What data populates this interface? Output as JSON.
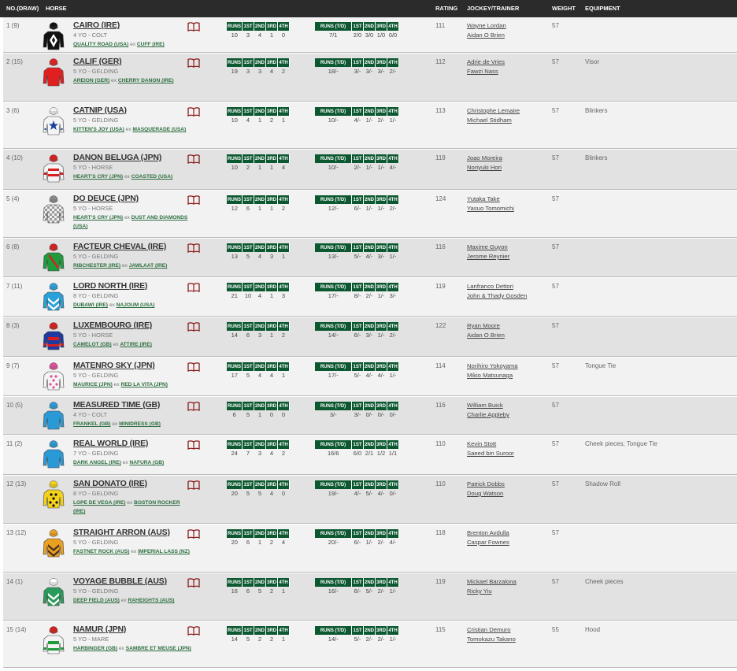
{
  "header": {
    "no_draw": "NO.(DRAW)",
    "horse": "HORSE",
    "rating": "RATING",
    "jockey_trainer": "JOCKEY/TRAINER",
    "weight": "WEIGHT",
    "equipment": "EQUIPMENT"
  },
  "stat_headers": {
    "runs": "RUNS",
    "runs_td": "RUNS (T/D)",
    "first": "1ST",
    "second": "2ND",
    "third": "3RD",
    "fourth": "4TH"
  },
  "pedigree_ex": "ex",
  "runners": [
    {
      "no": "1 (9)",
      "name": "CAIRO (IRE)",
      "info": "4 YO - COLT",
      "sire": "QUALITY ROAD (USA)",
      "dam": "CUFF (IRE)",
      "stats": [
        "10",
        "3",
        "4",
        "1",
        "0"
      ],
      "td": [
        "7/1",
        "2/0",
        "3/0",
        "1/0",
        "0/0"
      ],
      "rating": "111",
      "jockey": "Wayne Lordan",
      "trainer": "Aidan O Brien",
      "weight": "57",
      "equipment": "",
      "silk": {
        "body": "#111111",
        "accent": "#ffffff",
        "cap": "#111111",
        "pattern": "diamond"
      }
    },
    {
      "no": "2 (15)",
      "name": "CALIF (GER)",
      "info": "5 YO - GELDING",
      "sire": "AREION (GER)",
      "dam": "CHERRY DANON (IRE)",
      "stats": [
        "19",
        "3",
        "3",
        "4",
        "2"
      ],
      "td": [
        "18/-",
        "3/-",
        "3/-",
        "3/-",
        "2/-"
      ],
      "rating": "112",
      "jockey": "Adrie de Vries",
      "trainer": "Fawzi Nass",
      "weight": "57",
      "equipment": "Visor",
      "silk": {
        "body": "#e02020",
        "accent": "#e02020",
        "cap": "#e02020",
        "pattern": "plain"
      }
    },
    {
      "no": "3 (6)",
      "name": "CATNIP (USA)",
      "info": "5 YO - GELDING",
      "sire": "KITTEN'S JOY (USA)",
      "dam": "MASQUERADE (USA)",
      "stats": [
        "10",
        "4",
        "1",
        "2",
        "1"
      ],
      "td": [
        "10/-",
        "4/-",
        "1/-",
        "2/-",
        "1/-"
      ],
      "rating": "113",
      "jockey": "Christophe Lemaire",
      "trainer": "Michael Stidham",
      "weight": "57",
      "equipment": "Blinkers",
      "silk": {
        "body": "#f4f4f4",
        "accent": "#1a3d9c",
        "cap": "#f4f4f4",
        "pattern": "star"
      }
    },
    {
      "no": "4 (10)",
      "name": "DANON BELUGA (JPN)",
      "info": "5 YO - HORSE",
      "sire": "HEART'S CRY (JPN)",
      "dam": "COASTED (USA)",
      "stats": [
        "10",
        "2",
        "1",
        "1",
        "4"
      ],
      "td": [
        "10/-",
        "2/-",
        "1/-",
        "1/-",
        "4/-"
      ],
      "rating": "119",
      "jockey": "Joao Moreira",
      "trainer": "Noriyuki Hori",
      "weight": "57",
      "equipment": "Blinkers",
      "silk": {
        "body": "#f4f4f4",
        "accent": "#d81e1e",
        "cap": "#d81e1e",
        "pattern": "stripes"
      }
    },
    {
      "no": "5 (4)",
      "name": "DO DEUCE (JPN)",
      "info": "5 YO - HORSE",
      "sire": "HEART'S CRY (JPN)",
      "dam": "DUST AND DIAMONDS (USA)",
      "stats": [
        "12",
        "6",
        "1",
        "1",
        "2"
      ],
      "td": [
        "12/-",
        "6/-",
        "1/-",
        "1/-",
        "2/-"
      ],
      "rating": "124",
      "jockey": "Yutaka Take",
      "trainer": "Yasuo Tomomichi",
      "weight": "57",
      "equipment": "",
      "silk": {
        "body": "#9a9a9a",
        "accent": "#f0f0f0",
        "cap": "#888888",
        "pattern": "check"
      }
    },
    {
      "no": "6 (8)",
      "name": "FACTEUR CHEVAL (IRE)",
      "info": "5 YO - GELDING",
      "sire": "RIBCHESTER (IRE)",
      "dam": "JAWLAAT (IRE)",
      "stats": [
        "13",
        "5",
        "4",
        "3",
        "1"
      ],
      "td": [
        "13/-",
        "5/-",
        "4/-",
        "3/-",
        "1/-"
      ],
      "rating": "116",
      "jockey": "Maxime Guyon",
      "trainer": "Jerome Reynier",
      "weight": "57",
      "equipment": "",
      "silk": {
        "body": "#1f9a3c",
        "accent": "#d62020",
        "cap": "#d62020",
        "pattern": "sash"
      }
    },
    {
      "no": "7 (11)",
      "name": "LORD NORTH (IRE)",
      "info": "8 YO - GELDING",
      "sire": "DUBAWI (IRE)",
      "dam": "NAJOUM (USA)",
      "stats": [
        "21",
        "10",
        "4",
        "1",
        "3"
      ],
      "td": [
        "17/-",
        "8/-",
        "2/-",
        "1/-",
        "3/-"
      ],
      "rating": "119",
      "jockey": "Lanfranco Dettori",
      "trainer": "John & Thady Gosden",
      "weight": "57",
      "equipment": "",
      "silk": {
        "body": "#2aa0d8",
        "accent": "#ffffff",
        "cap": "#2aa0d8",
        "pattern": "chevron"
      }
    },
    {
      "no": "8 (3)",
      "name": "LUXEMBOURG (IRE)",
      "info": "5 YO - HORSE",
      "sire": "CAMELOT (GB)",
      "dam": "ATTIRE (IRE)",
      "stats": [
        "14",
        "6",
        "3",
        "1",
        "2"
      ],
      "td": [
        "14/-",
        "6/-",
        "3/-",
        "1/-",
        "2/-"
      ],
      "rating": "122",
      "jockey": "Ryan Moore",
      "trainer": "Aidan O Brien",
      "weight": "57",
      "equipment": "",
      "silk": {
        "body": "#1f3aa0",
        "accent": "#d81e1e",
        "cap": "#d81e1e",
        "pattern": "hoops"
      }
    },
    {
      "no": "9 (7)",
      "name": "MATENRO SKY (JPN)",
      "info": "5 YO - GELDING",
      "sire": "MAURICE (JPN)",
      "dam": "RED LA VITA (JPN)",
      "stats": [
        "17",
        "5",
        "4",
        "4",
        "1"
      ],
      "td": [
        "17/-",
        "5/-",
        "4/-",
        "4/-",
        "1/-"
      ],
      "rating": "114",
      "jockey": "Norihiro Yokoyama",
      "trainer": "Mikio Matsunaga",
      "weight": "57",
      "equipment": "Tongue Tie",
      "silk": {
        "body": "#f4f4f4",
        "accent": "#e0509a",
        "cap": "#e0509a",
        "pattern": "spots"
      }
    },
    {
      "no": "10 (5)",
      "name": "MEASURED TIME (GB)",
      "info": "4 YO - COLT",
      "sire": "FRANKEL (GB)",
      "dam": "MINIDRESS (GB)",
      "stats": [
        "6",
        "5",
        "1",
        "0",
        "0"
      ],
      "td": [
        "3/-",
        "3/-",
        "0/-",
        "0/-",
        "0/-"
      ],
      "rating": "116",
      "jockey": "William Buick",
      "trainer": "Charlie Appleby",
      "weight": "57",
      "equipment": "",
      "silk": {
        "body": "#2a9ad6",
        "accent": "#2a9ad6",
        "cap": "#2a9ad6",
        "pattern": "plain"
      }
    },
    {
      "no": "11 (2)",
      "name": "REAL WORLD (IRE)",
      "info": "7 YO - GELDING",
      "sire": "DARK ANGEL (IRE)",
      "dam": "NAFURA (GB)",
      "stats": [
        "24",
        "7",
        "3",
        "4",
        "2"
      ],
      "td": [
        "16/6",
        "6/0",
        "2/1",
        "1/2",
        "1/1"
      ],
      "rating": "110",
      "jockey": "Kevin Stott",
      "trainer": "Saeed bin Suroor",
      "weight": "57",
      "equipment": "Cheek pieces; Tongue Tie",
      "silk": {
        "body": "#2a9ad6",
        "accent": "#ffffff",
        "cap": "#2a9ad6",
        "pattern": "plain"
      }
    },
    {
      "no": "12 (13)",
      "name": "SAN DONATO (IRE)",
      "info": "8 YO - GELDING",
      "sire": "LOPE DE VEGA (IRE)",
      "dam": "BOSTON ROCKER (IRE)",
      "stats": [
        "20",
        "5",
        "5",
        "4",
        "0"
      ],
      "td": [
        "19/-",
        "4/-",
        "5/-",
        "4/-",
        "0/-"
      ],
      "rating": "110",
      "jockey": "Patrick Dobbs",
      "trainer": "Doug Watson",
      "weight": "57",
      "equipment": "Shadow Roll",
      "silk": {
        "body": "#f2d21a",
        "accent": "#111111",
        "cap": "#f2d21a",
        "pattern": "spots"
      }
    },
    {
      "no": "13 (12)",
      "name": "STRAIGHT ARRON (AUS)",
      "info": "5 YO - GELDING",
      "sire": "FASTNET ROCK (AUS)",
      "dam": "IMPERIAL LASS (NZ)",
      "stats": [
        "20",
        "6",
        "1",
        "2",
        "4"
      ],
      "td": [
        "20/-",
        "6/-",
        "1/-",
        "2/-",
        "4/-"
      ],
      "rating": "118",
      "jockey": "Brenton Avdulla",
      "trainer": "Caspar Fownes",
      "weight": "57",
      "equipment": "",
      "silk": {
        "body": "#e8a020",
        "accent": "#4a3020",
        "cap": "#e8a020",
        "pattern": "chevron"
      }
    },
    {
      "no": "14 (1)",
      "name": "VOYAGE BUBBLE (AUS)",
      "info": "5 YO - GELDING",
      "sire": "DEEP FIELD (AUS)",
      "dam": "RAHEIGHTS (AUS)",
      "stats": [
        "16",
        "6",
        "5",
        "2",
        "1"
      ],
      "td": [
        "16/-",
        "6/-",
        "5/-",
        "2/-",
        "1/-"
      ],
      "rating": "119",
      "jockey": "Mickael Barzalona",
      "trainer": "Ricky Yiu",
      "weight": "57",
      "equipment": "Cheek pieces",
      "silk": {
        "body": "#2a9a5a",
        "accent": "#ffffff",
        "cap": "#ffffff",
        "pattern": "chevron"
      }
    },
    {
      "no": "15 (14)",
      "name": "NAMUR (JPN)",
      "info": "5 YO - MARE",
      "sire": "HARBINGER (GB)",
      "dam": "SAMBRE ET MEUSE (JPN)",
      "stats": [
        "14",
        "5",
        "2",
        "2",
        "1"
      ],
      "td": [
        "14/-",
        "5/-",
        "2/-",
        "2/-",
        "1/-"
      ],
      "rating": "115",
      "jockey": "Cristian Demuro",
      "trainer": "Tomokazu Takano",
      "weight": "55",
      "equipment": "Hood",
      "silk": {
        "body": "#f4f4f4",
        "accent": "#1f9a3c",
        "cap": "#d62020",
        "pattern": "hoops"
      }
    }
  ]
}
